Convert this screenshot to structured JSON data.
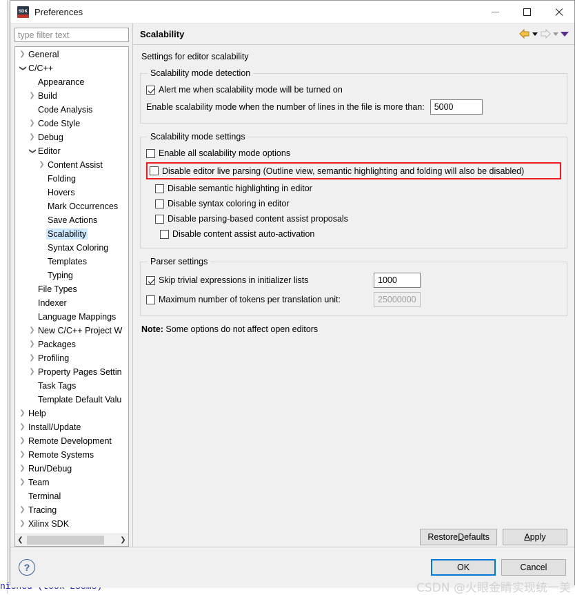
{
  "window": {
    "title": "Preferences",
    "icon": "sdk-icon",
    "icon_text": "SDK",
    "controls": {
      "minimize": "minimize-icon",
      "maximize": "maximize-icon",
      "close": "close-icon"
    }
  },
  "sidebar": {
    "filter_placeholder": "type filter text",
    "items": [
      {
        "label": "General",
        "indent": 0,
        "arrow": "collapsed"
      },
      {
        "label": "C/C++",
        "indent": 0,
        "arrow": "expanded"
      },
      {
        "label": "Appearance",
        "indent": 1,
        "arrow": "none"
      },
      {
        "label": "Build",
        "indent": 1,
        "arrow": "collapsed"
      },
      {
        "label": "Code Analysis",
        "indent": 1,
        "arrow": "none"
      },
      {
        "label": "Code Style",
        "indent": 1,
        "arrow": "collapsed"
      },
      {
        "label": "Debug",
        "indent": 1,
        "arrow": "collapsed"
      },
      {
        "label": "Editor",
        "indent": 1,
        "arrow": "expanded"
      },
      {
        "label": "Content Assist",
        "indent": 2,
        "arrow": "collapsed"
      },
      {
        "label": "Folding",
        "indent": 2,
        "arrow": "none"
      },
      {
        "label": "Hovers",
        "indent": 2,
        "arrow": "none"
      },
      {
        "label": "Mark Occurrences",
        "indent": 2,
        "arrow": "none"
      },
      {
        "label": "Save Actions",
        "indent": 2,
        "arrow": "none"
      },
      {
        "label": "Scalability",
        "indent": 2,
        "arrow": "none",
        "selected": true
      },
      {
        "label": "Syntax Coloring",
        "indent": 2,
        "arrow": "none"
      },
      {
        "label": "Templates",
        "indent": 2,
        "arrow": "none"
      },
      {
        "label": "Typing",
        "indent": 2,
        "arrow": "none"
      },
      {
        "label": "File Types",
        "indent": 1,
        "arrow": "none"
      },
      {
        "label": "Indexer",
        "indent": 1,
        "arrow": "none"
      },
      {
        "label": "Language Mappings",
        "indent": 1,
        "arrow": "none"
      },
      {
        "label": "New C/C++ Project W",
        "indent": 1,
        "arrow": "collapsed"
      },
      {
        "label": "Packages",
        "indent": 1,
        "arrow": "collapsed"
      },
      {
        "label": "Profiling",
        "indent": 1,
        "arrow": "collapsed"
      },
      {
        "label": "Property Pages Settin",
        "indent": 1,
        "arrow": "collapsed"
      },
      {
        "label": "Task Tags",
        "indent": 1,
        "arrow": "none"
      },
      {
        "label": "Template Default Valu",
        "indent": 1,
        "arrow": "none"
      },
      {
        "label": "Help",
        "indent": 0,
        "arrow": "collapsed"
      },
      {
        "label": "Install/Update",
        "indent": 0,
        "arrow": "collapsed"
      },
      {
        "label": "Remote Development",
        "indent": 0,
        "arrow": "collapsed"
      },
      {
        "label": "Remote Systems",
        "indent": 0,
        "arrow": "collapsed"
      },
      {
        "label": "Run/Debug",
        "indent": 0,
        "arrow": "collapsed"
      },
      {
        "label": "Team",
        "indent": 0,
        "arrow": "collapsed"
      },
      {
        "label": "Terminal",
        "indent": 0,
        "arrow": "none"
      },
      {
        "label": "Tracing",
        "indent": 0,
        "arrow": "collapsed"
      },
      {
        "label": "Xilinx SDK",
        "indent": 0,
        "arrow": "collapsed"
      }
    ],
    "hscroll": {
      "left_arrow": "chevron-left-icon",
      "right_arrow": "chevron-right-icon"
    }
  },
  "page": {
    "title": "Scalability",
    "subtitle": "Settings for editor scalability",
    "nav": {
      "back": "back-arrow-icon",
      "back_menu": "chevron-down-icon",
      "forward": "forward-arrow-icon",
      "forward_menu": "chevron-down-icon",
      "more_menu": "chevron-down-icon"
    },
    "groups": [
      {
        "legend": "Scalability mode detection",
        "checkbox": {
          "label": "Alert me when scalability mode will be turned on",
          "checked": true
        },
        "field_row": {
          "label": "Enable scalability mode when the number of lines in the file is more than:",
          "value": "5000"
        }
      },
      {
        "legend": "Scalability mode settings",
        "options": [
          {
            "label": "Enable all scalability mode options",
            "checked": false,
            "indent": 0,
            "highlighted": false
          },
          {
            "label": "Disable editor live parsing (Outline view, semantic highlighting and folding will also be disabled)",
            "checked": false,
            "indent": 1,
            "highlighted": true
          },
          {
            "label": "Disable semantic highlighting in editor",
            "checked": false,
            "indent": 1,
            "highlighted": false
          },
          {
            "label": "Disable syntax coloring in editor",
            "checked": false,
            "indent": 1,
            "highlighted": false
          },
          {
            "label": "Disable parsing-based content assist proposals",
            "checked": false,
            "indent": 1,
            "highlighted": false
          },
          {
            "label": "Disable content assist auto-activation",
            "checked": false,
            "indent": 2,
            "highlighted": false
          }
        ]
      },
      {
        "legend": "Parser settings",
        "rows": [
          {
            "label": "Skip trivial expressions in initializer lists",
            "checked": true,
            "value": "1000",
            "disabled": false
          },
          {
            "label": "Maximum number of tokens per translation unit:",
            "checked": false,
            "value": "25000000",
            "disabled": true
          }
        ]
      }
    ],
    "note_prefix": "Note:",
    "note_text": " Some options do not affect open editors"
  },
  "footer": {
    "restore_defaults": {
      "pre": "Restore ",
      "mnemonic": "D",
      "post": "efaults"
    },
    "apply": {
      "pre": "",
      "mnemonic": "A",
      "post": "pply"
    },
    "ok": "OK",
    "cancel": "Cancel",
    "help_icon": "question-mark-icon"
  },
  "background": {
    "status_text": "nished (took 288ms)",
    "left_glyphs": "*\n*\n*\ni\nt\nt\nt\nt\nn\nd\no\no\no\nd\no\np\n\nf\n\nG\n\n\nh\nh\n\nT\n\nt\n\n6\n2\n9"
  },
  "watermark": "CSDN @火眼金睛实现统一美",
  "colors": {
    "accent_highlight": "#ee1c1c",
    "selection": "#cde8ff",
    "focus": "#0078d7",
    "dialog_bg": "#f0f0f0"
  }
}
